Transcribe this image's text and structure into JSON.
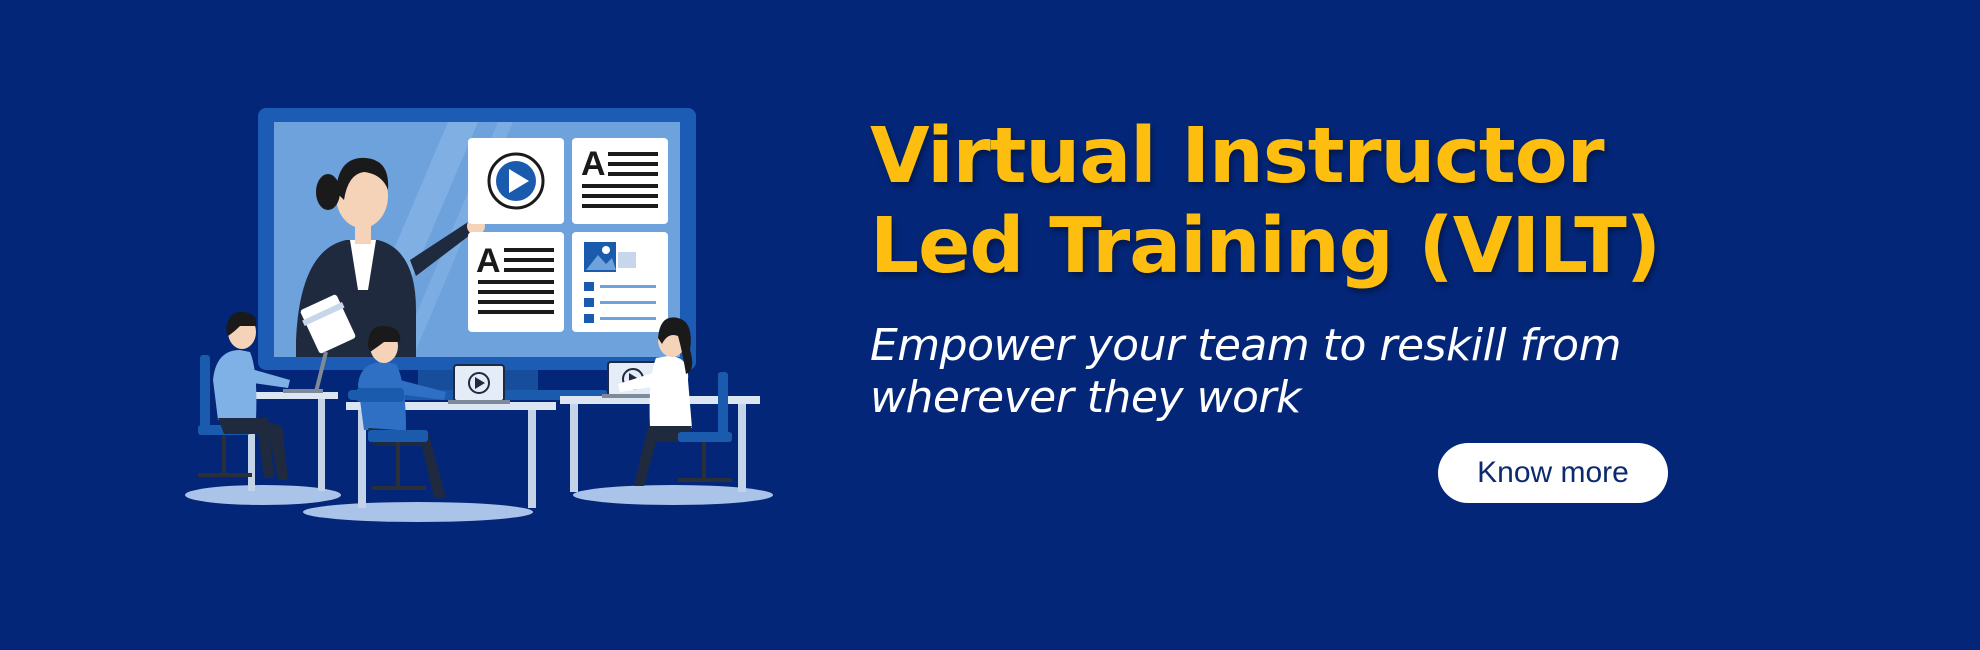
{
  "headline": {
    "line1": "Virtual Instructor",
    "line2": "Led Training (VILT)"
  },
  "subhead": {
    "line1": "Empower your team to reskill from",
    "line2": "wherever they work"
  },
  "cta": {
    "label": "Know more"
  },
  "colors": {
    "background": "#032678",
    "accent": "#FDBE0F",
    "text": "#FFFFFF",
    "button_bg": "#FFFFFF",
    "button_text": "#0B2A6F"
  },
  "illustration": {
    "icons": [
      "play-icon",
      "article-icon",
      "article-icon",
      "image-list-icon"
    ]
  }
}
